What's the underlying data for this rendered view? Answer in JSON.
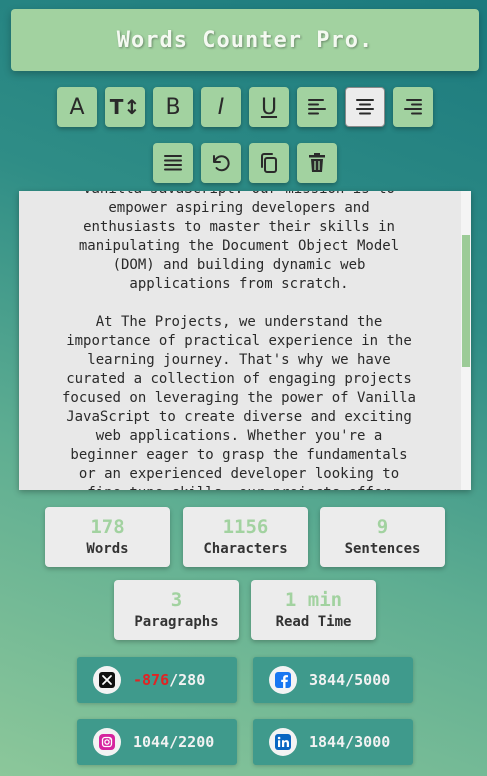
{
  "app": {
    "title": "Words Counter Pro."
  },
  "toolbar": {
    "font_label": "A",
    "size_label": "T↕",
    "bold_label": "B",
    "italic_label": "I",
    "underline_label": "U",
    "active_tool": "align-center"
  },
  "editor": {
    "text": "Vanilla JavaScript. Our mission is to\nempower aspiring developers and\nenthusiasts to master their skills in\nmanipulating the Document Object Model\n(DOM) and building dynamic web\napplications from scratch.\n\nAt The Projects, we understand the\nimportance of practical experience in the\nlearning journey. That's why we have\ncurated a collection of engaging projects\nfocused on leveraging the power of Vanilla\nJavaScript to create diverse and exciting\nweb applications. Whether you're a\nbeginner eager to grasp the fundamentals\nor an experienced developer looking to\nfine-tune skills, our projects offer"
  },
  "stats": {
    "words": {
      "value": "178",
      "label": "Words"
    },
    "characters": {
      "value": "1156",
      "label": "Characters"
    },
    "sentences": {
      "value": "9",
      "label": "Sentences"
    },
    "paragraphs": {
      "value": "3",
      "label": "Paragraphs"
    },
    "read_time": {
      "value": "1 min",
      "label": "Read Time"
    }
  },
  "social": {
    "x": {
      "remaining": "-876",
      "limit": "/280",
      "icon": "x-icon",
      "over_color": "#e02424"
    },
    "facebook": {
      "remaining": "3844",
      "limit": "/5000",
      "icon": "facebook-icon",
      "brand_color": "#1877f2"
    },
    "instagram": {
      "remaining": "1044",
      "limit": "/2200",
      "icon": "instagram-icon",
      "brand_color": "#d6249f"
    },
    "linkedin": {
      "remaining": "1844",
      "limit": "/3000",
      "icon": "linkedin-icon",
      "brand_color": "#0a66c2"
    }
  },
  "colors": {
    "accent": "#a2d2a0",
    "panel": "#e8e8e8",
    "social_bg": "#3f9a8c"
  }
}
